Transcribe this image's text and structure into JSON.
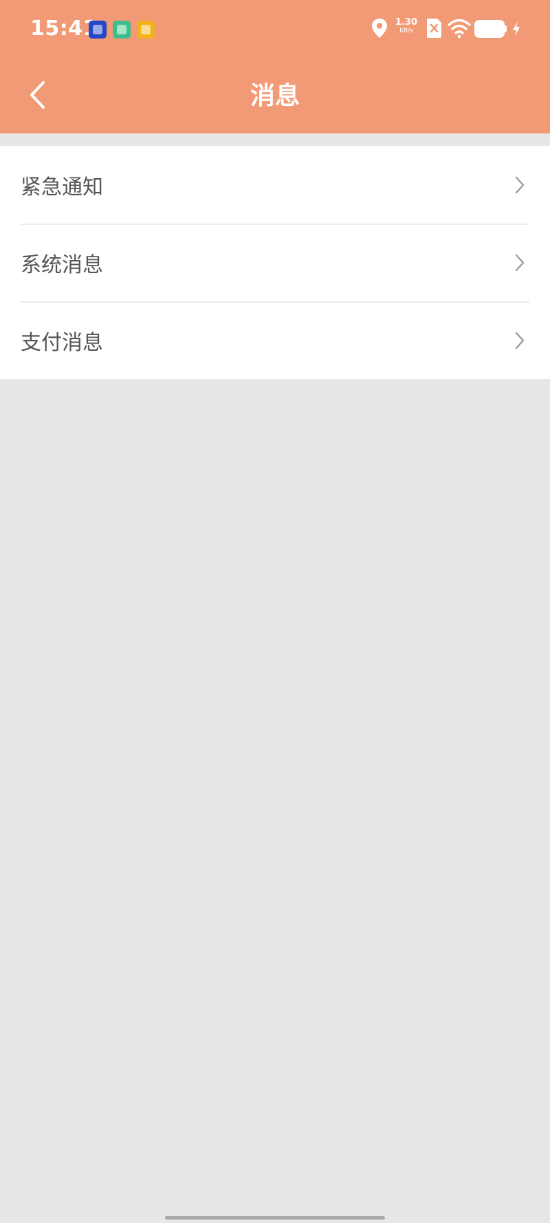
{
  "status_bar": {
    "time": "15:41",
    "net_speed_value": "1.30",
    "net_speed_unit": "KB/s",
    "icons": [
      "app-icon-blue",
      "app-icon-green",
      "app-icon-yellow",
      "location-icon",
      "sim-icon",
      "wifi-icon",
      "battery-icon",
      "charging-icon"
    ]
  },
  "header": {
    "title": "消息",
    "back_icon": "chevron-left-icon",
    "background": "#f29a76"
  },
  "messages": {
    "items": [
      {
        "label": "紧急通知"
      },
      {
        "label": "系统消息"
      },
      {
        "label": "支付消息"
      }
    ],
    "chevron_icon": "chevron-right-icon"
  },
  "colors": {
    "page_background": "#e7e7e7",
    "list_background": "#ffffff",
    "text": "#555555",
    "accent": "#f29a76"
  }
}
